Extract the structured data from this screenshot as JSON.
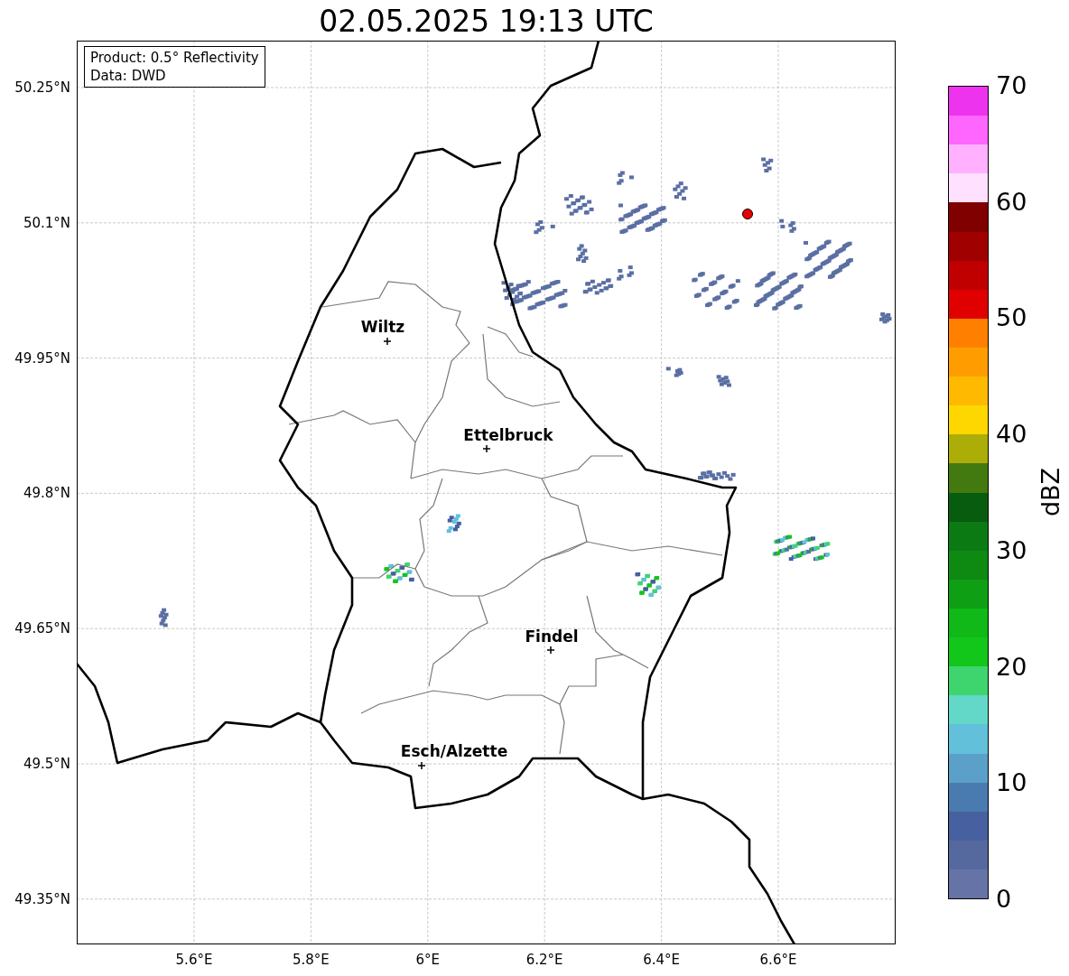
{
  "title": "02.05.2025 19:13 UTC",
  "info_box": {
    "lines": [
      "Product: 0.5° Reflectivity",
      "Data: DWD"
    ]
  },
  "map": {
    "x_ticks": [
      "5.6°E",
      "5.8°E",
      "6°E",
      "6.2°E",
      "6.4°E",
      "6.6°E"
    ],
    "y_ticks": [
      "50.25°N",
      "50.1°N",
      "49.95°N",
      "49.8°N",
      "49.65°N",
      "49.5°N",
      "49.35°N"
    ],
    "cities": [
      {
        "name": "Wiltz"
      },
      {
        "name": "Ettelbruck"
      },
      {
        "name": "Findel"
      },
      {
        "name": "Esch/Alzette"
      }
    ]
  },
  "colorbar": {
    "label": "dBZ",
    "ticks": [
      "70",
      "60",
      "50",
      "40",
      "30",
      "20",
      "10",
      "0"
    ],
    "bands": [
      {
        "color": "#ee33ee"
      },
      {
        "color": "#ff66ff"
      },
      {
        "color": "#ffb0ff"
      },
      {
        "color": "#ffe0ff"
      },
      {
        "color": "#800000"
      },
      {
        "color": "#a00000"
      },
      {
        "color": "#c00000"
      },
      {
        "color": "#e00000"
      },
      {
        "color": "#ff8000"
      },
      {
        "color": "#ff9d00"
      },
      {
        "color": "#ffb900"
      },
      {
        "color": "#ffd700"
      },
      {
        "color": "#adad08"
      },
      {
        "color": "#437a10"
      },
      {
        "color": "#085c10"
      },
      {
        "color": "#0c7a12"
      },
      {
        "color": "#0e8a13"
      },
      {
        "color": "#0f9f14"
      },
      {
        "color": "#10b818"
      },
      {
        "color": "#12c61a"
      },
      {
        "color": "#3ed56e"
      },
      {
        "color": "#63d8c8"
      },
      {
        "color": "#63c0da"
      },
      {
        "color": "#5aa0c8"
      },
      {
        "color": "#4a7bb0"
      },
      {
        "color": "#4660a0"
      },
      {
        "color": "#56699f"
      },
      {
        "color": "#6673a6"
      }
    ]
  }
}
